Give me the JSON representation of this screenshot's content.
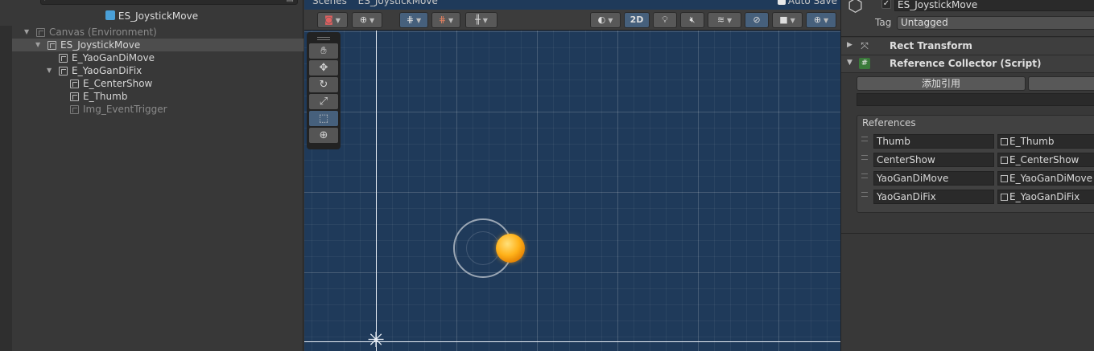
{
  "hierarchy": {
    "title": "ES_JoystickMove",
    "items": [
      {
        "label": "Canvas (Environment)",
        "depth": 0,
        "expanded": true,
        "dim": true,
        "selected": false
      },
      {
        "label": "ES_JoystickMove",
        "depth": 1,
        "expanded": true,
        "dim": false,
        "selected": true
      },
      {
        "label": "E_YaoGanDiMove",
        "depth": 2,
        "expanded": false,
        "dim": false,
        "selected": false
      },
      {
        "label": "E_YaoGanDiFix",
        "depth": 2,
        "expanded": true,
        "dim": false,
        "selected": false
      },
      {
        "label": "E_CenterShow",
        "depth": 3,
        "expanded": false,
        "dim": false,
        "selected": false
      },
      {
        "label": "E_Thumb",
        "depth": 3,
        "expanded": false,
        "dim": false,
        "selected": false
      },
      {
        "label": "Img_EventTrigger",
        "depth": 3,
        "expanded": false,
        "dim": true,
        "selected": false
      }
    ]
  },
  "scene": {
    "tab_label": "Scenes",
    "breadcrumb": "ES_JoystickMove",
    "auto_save_label": "Auto Save",
    "toolbar": {
      "mode_2d": "2D"
    },
    "tools": [
      "hand-tool",
      "move-tool",
      "rotate-tool",
      "scale-tool",
      "rect-tool",
      "transform-tool"
    ],
    "active_tool": "rect-tool"
  },
  "inspector": {
    "object_name": "ES_JoystickMove",
    "tag_label": "Tag",
    "tag_value": "Untagged",
    "components": [
      {
        "name": "Rect Transform",
        "icon": "rect-transform-icon",
        "collapsed": true
      },
      {
        "name": "Reference Collector (Script)",
        "icon": "script-icon",
        "collapsed": false
      }
    ],
    "add_reference_button": "添加引用",
    "references_title": "References",
    "references": [
      {
        "key": "Thumb",
        "value": "E_Thumb"
      },
      {
        "key": "CenterShow",
        "value": "E_CenterShow"
      },
      {
        "key": "YaoGanDiMove",
        "value": "E_YaoGanDiMove"
      },
      {
        "key": "YaoGanDiFix",
        "value": "E_YaoGanDiFix"
      }
    ]
  },
  "colors": {
    "scene_bg": "#1f3a5a",
    "selection": "#4d4d4d",
    "active_button": "#46607c",
    "thumb_orange": "#ffb21a"
  }
}
